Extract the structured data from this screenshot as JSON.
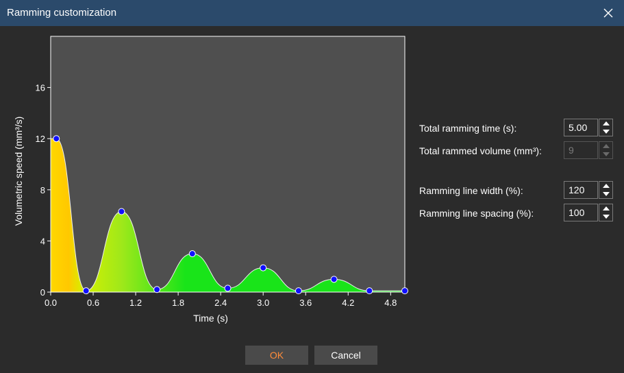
{
  "window": {
    "title": "Ramming customization"
  },
  "settings": {
    "total_time_label": "Total ramming time (s):",
    "total_time_value": "5.00",
    "total_volume_label": "Total rammed volume (mm³):",
    "total_volume_value": "9",
    "line_width_label": "Ramming line width (%):",
    "line_width_value": "120",
    "line_spacing_label": "Ramming line spacing (%):",
    "line_spacing_value": "100"
  },
  "buttons": {
    "ok_label": "OK",
    "cancel_label": "Cancel"
  },
  "colors": {
    "plot_background": "#4f4f4f",
    "handle": "#1010ff",
    "fill_start": "#ffd800",
    "fill_end": "#19e419",
    "ok_text": "#ff8c3a"
  },
  "chart_data": {
    "type": "area",
    "xlabel": "Time (s)",
    "ylabel": "Volumetric speed (mm³/s)",
    "xlim": [
      0,
      5.0
    ],
    "ylim": [
      0,
      20
    ],
    "x_ticks": [
      "0.0",
      "0.6",
      "1.2",
      "1.8",
      "2.4",
      "3.0",
      "3.6",
      "4.2",
      "4.8"
    ],
    "y_ticks": [
      "0",
      "4",
      "8",
      "12",
      "16"
    ],
    "points": [
      {
        "x": 0.08,
        "y": 12.0
      },
      {
        "x": 0.5,
        "y": 0.1
      },
      {
        "x": 1.0,
        "y": 6.3
      },
      {
        "x": 1.5,
        "y": 0.2
      },
      {
        "x": 2.0,
        "y": 3.0
      },
      {
        "x": 2.5,
        "y": 0.3
      },
      {
        "x": 3.0,
        "y": 1.9
      },
      {
        "x": 3.5,
        "y": 0.1
      },
      {
        "x": 4.0,
        "y": 1.0
      },
      {
        "x": 4.5,
        "y": 0.1
      },
      {
        "x": 5.0,
        "y": 0.1
      }
    ]
  }
}
